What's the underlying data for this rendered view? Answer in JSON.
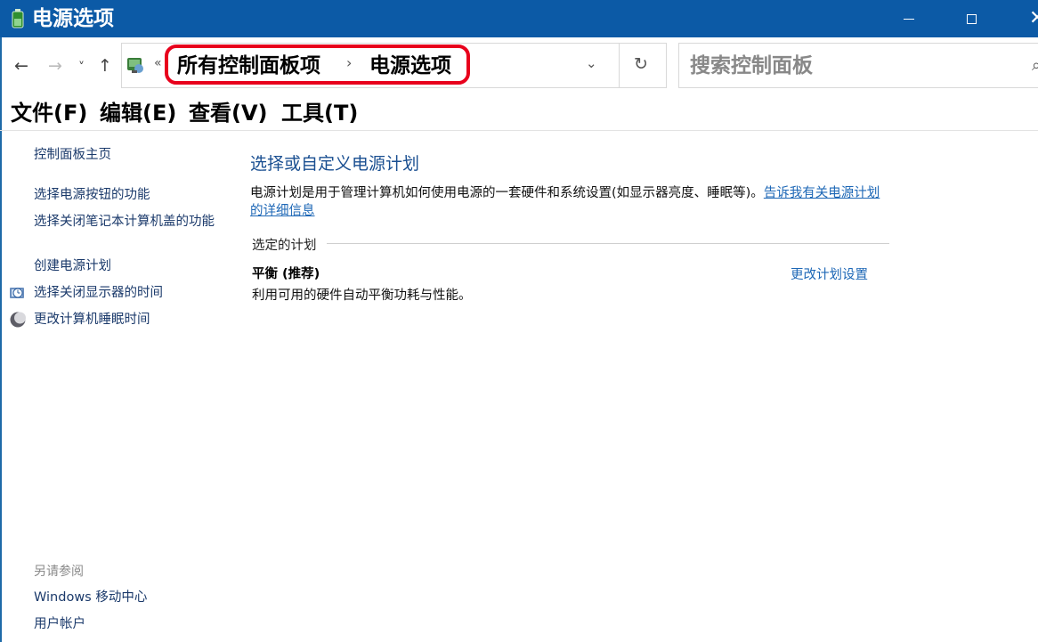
{
  "window": {
    "title": "电源选项",
    "minimize_icon": "minimize-icon",
    "maximize_icon": "maximize-icon",
    "close_icon": "close-icon"
  },
  "nav": {
    "back": "←",
    "forward": "→",
    "recent": "˅",
    "up": "↑"
  },
  "address": {
    "prefix": "«",
    "crumbs": [
      "所有控制面板项",
      "电源选项"
    ],
    "separator": "›",
    "dropdown": "⌄",
    "refresh": "↻",
    "highlight_color": "#e8001c"
  },
  "search": {
    "placeholder": "搜索控制面板"
  },
  "menu": {
    "file": "文件(F)",
    "edit": "编辑(E)",
    "view": "查看(V)",
    "tools": "工具(T)"
  },
  "sidebar": {
    "home": "控制面板主页",
    "items": [
      {
        "label": "选择电源按钮的功能",
        "icon": null
      },
      {
        "label": "选择关闭笔记本计算机盖的功能",
        "icon": null
      },
      {
        "label": "创建电源计划",
        "icon": null
      },
      {
        "label": "选择关闭显示器的时间",
        "icon": "monitor-clock-icon"
      },
      {
        "label": "更改计算机睡眠时间",
        "icon": "moon-icon"
      }
    ],
    "see_also_title": "另请参阅",
    "see_also": [
      "Windows 移动中心",
      "用户帐户"
    ]
  },
  "main": {
    "title": "选择或自定义电源计划",
    "description": "电源计划是用于管理计算机如何使用电源的一套硬件和系统设置(如显示器亮度、睡眠等)。",
    "description_link": "告诉我有关电源计划的详细信息",
    "section_label": "选定的计划",
    "plan": {
      "name": "平衡 (推荐)",
      "description": "利用可用的硬件自动平衡功耗与性能。",
      "change_link": "更改计划设置"
    }
  },
  "colors": {
    "titlebar": "#0c5aa6",
    "link": "#1d67b6",
    "heading": "#1a4f91"
  }
}
